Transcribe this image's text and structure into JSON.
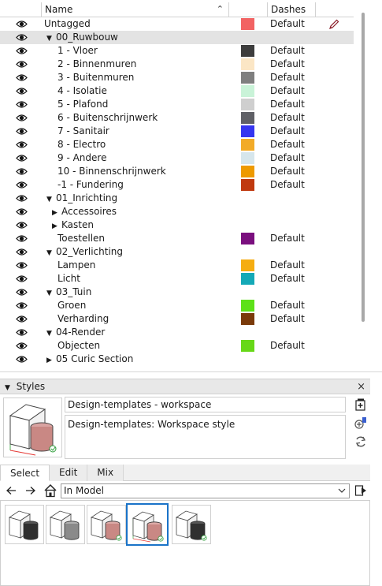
{
  "tags": {
    "columns": {
      "name": "Name",
      "dashes": "Dashes"
    },
    "rows": [
      {
        "name": "Untagged",
        "level": 0,
        "expander": "",
        "color": "#f26363",
        "dashes": "Default",
        "editable": true
      },
      {
        "name": "00_Ruwbouw",
        "level": 0,
        "expander": "expanded",
        "color": "",
        "dashes": "",
        "selected": true
      },
      {
        "name": "1 - Vloer",
        "level": 1,
        "expander": "",
        "color": "#3d3d3d",
        "dashes": "Default"
      },
      {
        "name": "2 - Binnenmuren",
        "level": 1,
        "expander": "",
        "color": "#fbe6c5",
        "dashes": "Default"
      },
      {
        "name": "3 - Buitenmuren",
        "level": 1,
        "expander": "",
        "color": "#7f7f7f",
        "dashes": "Default"
      },
      {
        "name": "4 - Isolatie",
        "level": 1,
        "expander": "",
        "color": "#c9f3d8",
        "dashes": "Default"
      },
      {
        "name": "5 - Plafond",
        "level": 1,
        "expander": "",
        "color": "#cfcfcf",
        "dashes": "Default"
      },
      {
        "name": "6 - Buitenschrijnwerk",
        "level": 1,
        "expander": "",
        "color": "#5f6066",
        "dashes": "Default"
      },
      {
        "name": "7 - Sanitair",
        "level": 1,
        "expander": "",
        "color": "#3535f0",
        "dashes": "Default"
      },
      {
        "name": "8 - Electro",
        "level": 1,
        "expander": "",
        "color": "#f2ab28",
        "dashes": "Default"
      },
      {
        "name": "9 - Andere",
        "level": 1,
        "expander": "",
        "color": "#d6e6ec",
        "dashes": "Default"
      },
      {
        "name": "10 - Binnenschrijnwerk",
        "level": 1,
        "expander": "",
        "color": "#ee9a00",
        "dashes": "Default"
      },
      {
        "name": "-1 - Fundering",
        "level": 1,
        "expander": "",
        "color": "#c0390f",
        "dashes": "Default"
      },
      {
        "name": "01_Inrichting",
        "level": 0,
        "expander": "expanded",
        "color": "",
        "dashes": ""
      },
      {
        "name": "Accessoires",
        "level": 1,
        "expander": "collapsed",
        "color": "",
        "dashes": ""
      },
      {
        "name": "Kasten",
        "level": 1,
        "expander": "collapsed",
        "color": "",
        "dashes": ""
      },
      {
        "name": "Toestellen",
        "level": 1,
        "expander": "",
        "color": "#7a0f7e",
        "dashes": "Default"
      },
      {
        "name": "02_Verlichting",
        "level": 0,
        "expander": "expanded",
        "color": "",
        "dashes": ""
      },
      {
        "name": "Lampen",
        "level": 1,
        "expander": "",
        "color": "#f5ad12",
        "dashes": "Default"
      },
      {
        "name": "Licht",
        "level": 1,
        "expander": "",
        "color": "#14a9b7",
        "dashes": "Default"
      },
      {
        "name": "03_Tuin",
        "level": 0,
        "expander": "expanded",
        "color": "",
        "dashes": ""
      },
      {
        "name": "Groen",
        "level": 1,
        "expander": "",
        "color": "#5de118",
        "dashes": "Default"
      },
      {
        "name": "Verharding",
        "level": 1,
        "expander": "",
        "color": "#7a3a0a",
        "dashes": "Default"
      },
      {
        "name": "04-Render",
        "level": 0,
        "expander": "expanded",
        "color": "",
        "dashes": ""
      },
      {
        "name": "Objecten",
        "level": 1,
        "expander": "",
        "color": "#67d817",
        "dashes": "Default"
      },
      {
        "name": "05 Curic Section",
        "level": 0,
        "expander": "collapsed",
        "color": "",
        "dashes": ""
      }
    ]
  },
  "styles": {
    "panel_title": "Styles",
    "style_name": "Design-templates - workspace",
    "style_description": "Design-templates:  Workspace style",
    "tabs": [
      {
        "label": "Select",
        "active": true
      },
      {
        "label": "Edit",
        "active": false
      },
      {
        "label": "Mix",
        "active": false
      }
    ],
    "collection": "In Model",
    "thumbnails": [
      {
        "name": "style-dark-box",
        "variant": "dark",
        "selected": false
      },
      {
        "name": "style-gray-box",
        "variant": "gray",
        "selected": false
      },
      {
        "name": "style-pink-box",
        "variant": "pink",
        "selected": false
      },
      {
        "name": "style-workspace",
        "variant": "workspace",
        "selected": true
      },
      {
        "name": "style-dark-green",
        "variant": "darkgreen",
        "selected": false
      }
    ]
  }
}
